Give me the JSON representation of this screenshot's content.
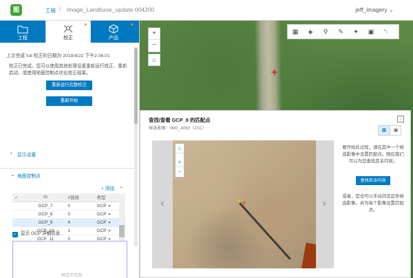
{
  "header": {
    "logo_text": "图",
    "project_link": "工程",
    "separator": "/",
    "project_name": "Image_Landbase_update 004200",
    "user": "jeff_imagery"
  },
  "tabs": [
    {
      "label": "工程",
      "icon": "folder-icon"
    },
    {
      "label": "校正",
      "icon": "drone-icon"
    },
    {
      "label": "产品",
      "icon": "cube-icon"
    }
  ],
  "adjust": {
    "last_done": "上次完成 full 校正的日期为  2018/4/22  下午2:06:01",
    "description": "校正已完成。您可以使用其他处理设置重新运行校正、重新启动、或使用地面控制点优化校正结果。",
    "rerun_button": "重新运行完整校正",
    "restart_button": "重新开始"
  },
  "display_settings": "显示设置",
  "gcp_section": {
    "title": "地面控制点",
    "add_label": "+ 添加",
    "columns": [
      "ID",
      "#链接",
      "类型"
    ],
    "rows": [
      {
        "id": "GCP_7",
        "links": "0",
        "type": "GCP"
      },
      {
        "id": "GCP_8",
        "links": "0",
        "type": "GCP"
      },
      {
        "id": "GCP_9",
        "links": "4",
        "type": "GCP"
      },
      {
        "id": "GCP_10",
        "links": "1",
        "type": "GCP"
      },
      {
        "id": "GCP_11",
        "links": "0",
        "type": "GCP"
      }
    ],
    "selected_row": 2,
    "show_detail": "显示 GCP 详细信息",
    "preview_unavailable": "预览不可用"
  },
  "map": {
    "zoom_in": "+",
    "zoom_out": "−"
  },
  "dialog": {
    "title": "查找/查看 GCP_9 的匹配点",
    "candidate": "候选影像：IMG_4083（2/11）",
    "help_1": "要开始此过程，请在其中一个候选影像中设置匹配点。随后我们可以为您查找其余内容。",
    "find_button": "查找其余内容",
    "help_2": "或者，您也可以手动浏览这些候选影像，并为每个影像设置匹配点。"
  },
  "colors": {
    "accent": "#0079c1",
    "logo": "#3fa535"
  }
}
